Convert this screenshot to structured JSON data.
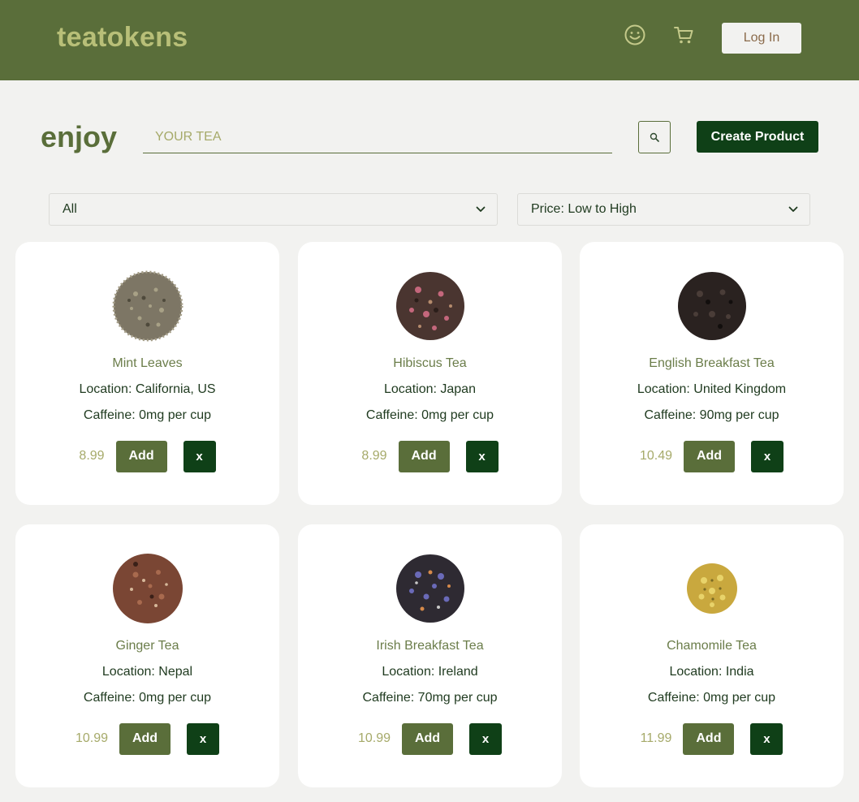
{
  "header": {
    "logo": "teatokens",
    "icons": [
      "smiley-icon",
      "cart-icon"
    ],
    "login_label": "Log In"
  },
  "search": {
    "heading": "enjoy",
    "placeholder": "YOUR TEA",
    "value": "",
    "create_label": "Create Product"
  },
  "filters": {
    "category": "All",
    "sort": "Price: Low to High"
  },
  "products": [
    {
      "name": "Mint Leaves",
      "location": "Location: California, US",
      "caffeine": "Caffeine: 0mg per cup",
      "price": "8.99",
      "add": "Add",
      "remove": "x"
    },
    {
      "name": "Hibiscus Tea",
      "location": "Location: Japan",
      "caffeine": "Caffeine: 0mg per cup",
      "price": "8.99",
      "add": "Add",
      "remove": "x"
    },
    {
      "name": "English Breakfast Tea",
      "location": "Location: United Kingdom",
      "caffeine": "Caffeine: 90mg per cup",
      "price": "10.49",
      "add": "Add",
      "remove": "x"
    },
    {
      "name": "Ginger Tea",
      "location": "Location: Nepal",
      "caffeine": "Caffeine: 0mg per cup",
      "price": "10.99",
      "add": "Add",
      "remove": "x"
    },
    {
      "name": "Irish Breakfast Tea",
      "location": "Location: Ireland",
      "caffeine": "Caffeine: 70mg per cup",
      "price": "10.99",
      "add": "Add",
      "remove": "x"
    },
    {
      "name": "Chamomile Tea",
      "location": "Location: India",
      "caffeine": "Caffeine: 0mg per cup",
      "price": "11.99",
      "add": "Add",
      "remove": "x"
    }
  ],
  "colors": {
    "header_bg": "#5a6e3a",
    "logo": "#b8bf78",
    "dark_green": "#0f4017",
    "price": "#a6aa6a"
  }
}
